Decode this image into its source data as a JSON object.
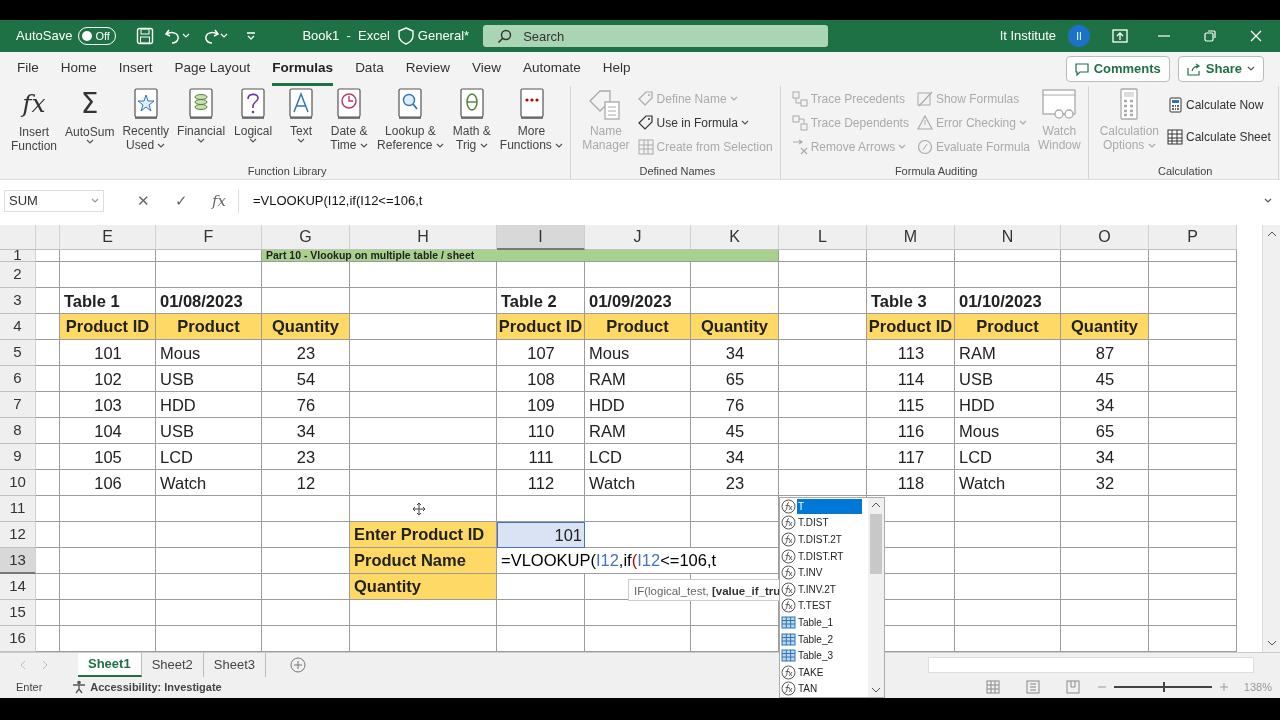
{
  "title_bar": {
    "autosave_label": "AutoSave",
    "autosave": {
      "on": false,
      "label": "Off"
    },
    "document_title": "Book1  -  Excel",
    "sensitivity": "General*",
    "search": {
      "placeholder": "Search"
    },
    "user_name": "It Institute",
    "avatar_initials": "II"
  },
  "ribbon_tabs": [
    {
      "label": "File",
      "selected": false
    },
    {
      "label": "Home",
      "selected": false
    },
    {
      "label": "Insert",
      "selected": false
    },
    {
      "label": "Page Layout",
      "selected": false
    },
    {
      "label": "Formulas",
      "selected": true
    },
    {
      "label": "Data",
      "selected": false
    },
    {
      "label": "Review",
      "selected": false
    },
    {
      "label": "View",
      "selected": false
    },
    {
      "label": "Automate",
      "selected": false
    },
    {
      "label": "Help",
      "selected": false
    }
  ],
  "comments_button": "Comments",
  "share_button": "Share",
  "ribbon_groups": [
    {
      "title": "Function Library",
      "buttons": [
        {
          "kind": "large",
          "lines": [
            "Insert",
            "Function"
          ],
          "icon_text": "fx",
          "dropdown": false,
          "disabled": false
        },
        {
          "kind": "large",
          "lines": [
            "AutoSum"
          ],
          "icon_text": "Σ",
          "dropdown": true,
          "disabled": false
        },
        {
          "kind": "large",
          "lines": [
            "Recently",
            "Used"
          ],
          "dropdown": true,
          "disabled": false
        },
        {
          "kind": "large",
          "lines": [
            "Financial"
          ],
          "dropdown": true,
          "disabled": false
        },
        {
          "kind": "large",
          "lines": [
            "Logical"
          ],
          "dropdown": true,
          "disabled": false
        },
        {
          "kind": "large",
          "lines": [
            "Text"
          ],
          "dropdown": true,
          "disabled": false
        },
        {
          "kind": "large",
          "lines": [
            "Date &",
            "Time"
          ],
          "dropdown": true,
          "disabled": false
        },
        {
          "kind": "large",
          "lines": [
            "Lookup &",
            "Reference"
          ],
          "dropdown": true,
          "disabled": false
        },
        {
          "kind": "large",
          "lines": [
            "Math &",
            "Trig"
          ],
          "dropdown": true,
          "disabled": false
        },
        {
          "kind": "large",
          "lines": [
            "More",
            "Functions"
          ],
          "dropdown": true,
          "disabled": false
        }
      ]
    },
    {
      "title": "Defined Names",
      "buttons": [
        {
          "kind": "large",
          "lines": [
            "Name",
            "Manager"
          ],
          "dropdown": false,
          "disabled": true
        },
        {
          "kind": "small",
          "lines": [
            "Define Name"
          ],
          "dropdown": true,
          "disabled": true
        },
        {
          "kind": "small",
          "lines": [
            "Use in Formula"
          ],
          "dropdown": true,
          "disabled": false
        },
        {
          "kind": "small",
          "lines": [
            "Create from Selection"
          ],
          "dropdown": false,
          "disabled": true
        }
      ]
    },
    {
      "title": "Formula Auditing",
      "buttons": [
        {
          "kind": "small",
          "lines": [
            "Trace Precedents"
          ],
          "dropdown": false,
          "disabled": true
        },
        {
          "kind": "small",
          "lines": [
            "Trace Dependents"
          ],
          "dropdown": false,
          "disabled": true
        },
        {
          "kind": "small",
          "lines": [
            "Remove Arrows"
          ],
          "dropdown": true,
          "disabled": true
        },
        {
          "kind": "small",
          "lines": [
            "Show Formulas"
          ],
          "dropdown": false,
          "disabled": true
        },
        {
          "kind": "small",
          "lines": [
            "Error Checking"
          ],
          "dropdown": true,
          "disabled": true
        },
        {
          "kind": "small",
          "lines": [
            "Evaluate Formula"
          ],
          "dropdown": false,
          "disabled": true
        },
        {
          "kind": "large",
          "lines": [
            "Watch",
            "Window"
          ],
          "dropdown": false,
          "disabled": true
        }
      ]
    },
    {
      "title": "Calculation",
      "buttons": [
        {
          "kind": "large",
          "lines": [
            "Calculation",
            "Options"
          ],
          "dropdown": true,
          "disabled": true
        },
        {
          "kind": "small",
          "lines": [
            "Calculate Now"
          ],
          "dropdown": false,
          "disabled": false
        },
        {
          "kind": "small",
          "lines": [
            "Calculate Sheet"
          ],
          "dropdown": false,
          "disabled": false
        }
      ]
    }
  ],
  "formula_bar": {
    "name_box": "SUM",
    "buttons": [
      "✕",
      "✓",
      "fx"
    ],
    "formula": "=VLOOKUP(I12,if(I12<=106,t"
  },
  "sheet": {
    "columns": [
      {
        "label": "E",
        "selected": false
      },
      {
        "label": "F",
        "selected": false
      },
      {
        "label": "G",
        "selected": false
      },
      {
        "label": "H",
        "selected": false
      },
      {
        "label": "I",
        "selected": true
      },
      {
        "label": "J",
        "selected": false
      },
      {
        "label": "K",
        "selected": false
      },
      {
        "label": "L",
        "selected": false
      },
      {
        "label": "M",
        "selected": false
      },
      {
        "label": "N",
        "selected": false
      },
      {
        "label": "O",
        "selected": false
      },
      {
        "label": "P",
        "selected": false
      }
    ],
    "rows": [
      {
        "number": "1",
        "selected": false,
        "cells": [
          "",
          "",
          {
            "kind": "title",
            "text": "Part 10 - Vlookup on multiple table / sheet"
          }
        ]
      },
      {
        "number": "2",
        "selected": false
      },
      {
        "number": "3",
        "selected": false,
        "cells": [
          {
            "kind": "heading",
            "text": "Table 1"
          },
          {
            "kind": "heading",
            "text": "01/08/2023"
          },
          "",
          "",
          {
            "kind": "heading",
            "text": "Table 2"
          },
          {
            "kind": "heading",
            "text": "01/09/2023"
          },
          "",
          "",
          {
            "kind": "heading",
            "text": "Table 3"
          },
          {
            "kind": "heading",
            "text": "01/10/2023"
          }
        ]
      },
      {
        "number": "4",
        "selected": false,
        "cells": [
          {
            "kind": "header",
            "text": "Product ID"
          },
          {
            "kind": "header",
            "text": "Product"
          },
          {
            "kind": "header",
            "text": "Quantity"
          },
          "",
          {
            "kind": "header",
            "text": "Product ID"
          },
          {
            "kind": "header",
            "text": "Product"
          },
          {
            "kind": "header",
            "text": "Quantity"
          },
          "",
          {
            "kind": "header",
            "text": "Product ID"
          },
          {
            "kind": "header",
            "text": "Product"
          },
          {
            "kind": "header",
            "text": "Quantity"
          }
        ]
      },
      {
        "number": "5",
        "selected": false,
        "cells": [
          {
            "kind": "value",
            "text": "101"
          },
          {
            "kind": "item",
            "text": "Mous"
          },
          {
            "kind": "value",
            "text": "23"
          },
          "",
          {
            "kind": "value",
            "text": "107"
          },
          {
            "kind": "item",
            "text": "Mous"
          },
          {
            "kind": "value",
            "text": "34"
          },
          "",
          {
            "kind": "value",
            "text": "113"
          },
          {
            "kind": "item",
            "text": "RAM"
          },
          {
            "kind": "value",
            "text": "87"
          }
        ]
      },
      {
        "number": "6",
        "selected": false,
        "cells": [
          {
            "kind": "value",
            "text": "102"
          },
          {
            "kind": "item",
            "text": "USB"
          },
          {
            "kind": "value",
            "text": "54"
          },
          "",
          {
            "kind": "value",
            "text": "108"
          },
          {
            "kind": "item",
            "text": "RAM"
          },
          {
            "kind": "value",
            "text": "65"
          },
          "",
          {
            "kind": "value",
            "text": "114"
          },
          {
            "kind": "item",
            "text": "USB"
          },
          {
            "kind": "value",
            "text": "45"
          }
        ]
      },
      {
        "number": "7",
        "selected": false,
        "cells": [
          {
            "kind": "value",
            "text": "103"
          },
          {
            "kind": "item",
            "text": "HDD"
          },
          {
            "kind": "value",
            "text": "76"
          },
          "",
          {
            "kind": "value",
            "text": "109"
          },
          {
            "kind": "item",
            "text": "HDD"
          },
          {
            "kind": "value",
            "text": "76"
          },
          "",
          {
            "kind": "value",
            "text": "115"
          },
          {
            "kind": "item",
            "text": "HDD"
          },
          {
            "kind": "value",
            "text": "34"
          }
        ]
      },
      {
        "number": "8",
        "selected": false,
        "cells": [
          {
            "kind": "value",
            "text": "104"
          },
          {
            "kind": "item",
            "text": "USB"
          },
          {
            "kind": "value",
            "text": "34"
          },
          "",
          {
            "kind": "value",
            "text": "110"
          },
          {
            "kind": "item",
            "text": "RAM"
          },
          {
            "kind": "value",
            "text": "45"
          },
          "",
          {
            "kind": "value",
            "text": "116"
          },
          {
            "kind": "item",
            "text": "Mous"
          },
          {
            "kind": "value",
            "text": "65"
          }
        ]
      },
      {
        "number": "9",
        "selected": false,
        "cells": [
          {
            "kind": "value",
            "text": "105"
          },
          {
            "kind": "item",
            "text": "LCD"
          },
          {
            "kind": "value",
            "text": "23"
          },
          "",
          {
            "kind": "value",
            "text": "111"
          },
          {
            "kind": "item",
            "text": "LCD"
          },
          {
            "kind": "value",
            "text": "34"
          },
          "",
          {
            "kind": "value",
            "text": "117"
          },
          {
            "kind": "item",
            "text": "LCD"
          },
          {
            "kind": "value",
            "text": "34"
          }
        ]
      },
      {
        "number": "10",
        "selected": false,
        "cells": [
          {
            "kind": "value",
            "text": "106"
          },
          {
            "kind": "item",
            "text": "Watch"
          },
          {
            "kind": "value",
            "text": "12"
          },
          "",
          {
            "kind": "value",
            "text": "112"
          },
          {
            "kind": "item",
            "text": "Watch"
          },
          {
            "kind": "value",
            "text": "23"
          },
          "",
          {
            "kind": "value",
            "text": "118"
          },
          {
            "kind": "item",
            "text": "Watch"
          },
          {
            "kind": "value",
            "text": "32"
          }
        ]
      },
      {
        "number": "11",
        "selected": false
      },
      {
        "number": "12",
        "selected": false,
        "cells": [
          "",
          "",
          "",
          {
            "kind": "prompt",
            "text": "Enter Product ID"
          },
          {
            "kind": "entry",
            "text": "101",
            "selected": true
          }
        ]
      },
      {
        "number": "13",
        "selected": true,
        "cells": [
          "",
          "",
          "",
          {
            "kind": "prompt",
            "text": "Product Name"
          },
          {
            "kind": "formula",
            "parts": [
              {
                "text": "=VLOOKUP(",
                "color": "#000000"
              },
              {
                "text": "I12",
                "color": "#4472c4"
              },
              {
                "text": ",if",
                "color": "#000000"
              },
              {
                "text": "(",
                "color": "#c00000"
              },
              {
                "text": "I12",
                "color": "#4472c4"
              },
              {
                "text": "<=106,t",
                "color": "#000000"
              }
            ]
          }
        ]
      },
      {
        "number": "14",
        "selected": false,
        "cells": [
          "",
          "",
          "",
          {
            "kind": "prompt",
            "text": "Quantity"
          }
        ]
      },
      {
        "number": "15",
        "selected": false
      },
      {
        "number": "16",
        "selected": false
      }
    ]
  },
  "tooltip": "IF(logical_test, **[value_if_tru**",
  "autocomplete": [
    {
      "label": "T",
      "kind": "function",
      "selected": true
    },
    {
      "label": "T.DIST",
      "kind": "function",
      "selected": false
    },
    {
      "label": "T.DIST.2T",
      "kind": "function",
      "selected": false
    },
    {
      "label": "T.DIST.RT",
      "kind": "function",
      "selected": false
    },
    {
      "label": "T.INV",
      "kind": "function",
      "selected": false
    },
    {
      "label": "T.INV.2T",
      "kind": "function",
      "selected": false
    },
    {
      "label": "T.TEST",
      "kind": "function",
      "selected": false
    },
    {
      "label": "Table_1",
      "kind": "table",
      "selected": false
    },
    {
      "label": "Table_2",
      "kind": "table",
      "selected": false
    },
    {
      "label": "Table_3",
      "kind": "table",
      "selected": false
    },
    {
      "label": "TAKE",
      "kind": "function",
      "selected": false
    },
    {
      "label": "TAN",
      "kind": "function",
      "selected": false
    }
  ],
  "sheet_tabs": [
    {
      "label": "Sheet1",
      "selected": true
    },
    {
      "label": "Sheet2",
      "selected": false
    },
    {
      "label": "Sheet3",
      "selected": false
    }
  ],
  "status_bar": {
    "mode": "Enter",
    "accessibility": "Accessibility: Investigate",
    "zoom": {
      "level": 0.5,
      "label": "138%"
    }
  }
}
